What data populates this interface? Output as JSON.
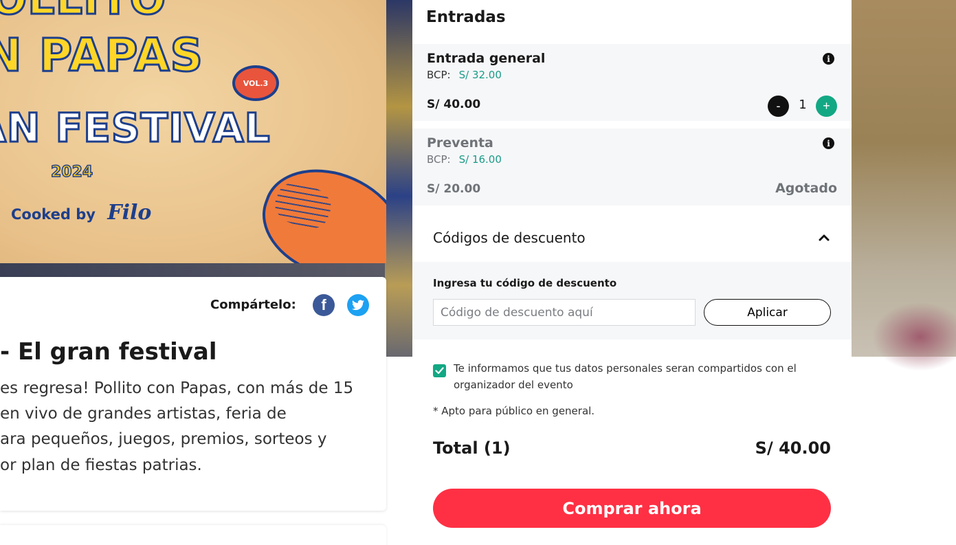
{
  "hero": {
    "line1": "POLLITO",
    "line2": "CON PAPAS",
    "line3": "EL GRAN FESTIVAL",
    "vol": "VOL.3",
    "year": "2024",
    "cooked_by": "Cooked by",
    "brand": "Filo"
  },
  "event": {
    "share_label": "Compártelo:",
    "title": "- El gran festival",
    "description_lines": [
      "es regresa! Pollito con Papas, con más de 15",
      "en vivo de grandes artistas, feria de",
      "ara pequeños, juegos, premios, sorteos y",
      "or plan de fiestas patrias."
    ]
  },
  "tickets": {
    "title": "Entradas",
    "items": [
      {
        "name": "Entrada general",
        "bcp_label": "BCP:",
        "bcp_price": "S/ 32.00",
        "price": "S/ 40.00",
        "quantity": "1",
        "minus": "-",
        "plus": "+",
        "status": ""
      },
      {
        "name": "Preventa",
        "bcp_label": "BCP:",
        "bcp_price": "S/ 16.00",
        "price": "S/ 20.00",
        "status": "Agotado"
      }
    ]
  },
  "discount": {
    "title": "Códigos de descuento",
    "label": "Ingresa tu código de descuento",
    "placeholder": "Código de descuento aquí",
    "apply_label": "Aplicar"
  },
  "consent": {
    "checked": true,
    "text": "Te informamos que tus datos personales seran compartidos con el organizador del evento"
  },
  "note": "* Apto para público en general.",
  "total": {
    "label": "Total (1)",
    "amount": "S/ 40.00"
  },
  "buy_label": "Comprar ahora",
  "colors": {
    "accent_green": "#13a884",
    "buy_red": "#ff3044",
    "bcp_teal": "#1a9b88",
    "muted_gray": "#6f7378"
  },
  "icons": {
    "info": "info-icon",
    "chevron": "chevron-up-icon",
    "facebook": "facebook-icon",
    "twitter": "twitter-icon",
    "check": "check-icon"
  }
}
